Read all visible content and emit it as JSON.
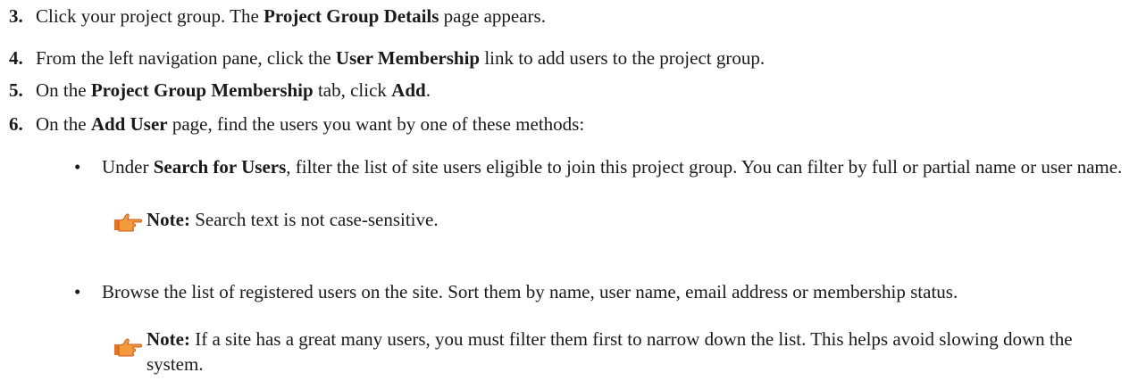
{
  "steps": [
    {
      "num": "3.",
      "pre": "Click your project group. The ",
      "bold1": "Project Group Details",
      "post": " page appears."
    },
    {
      "num": "4.",
      "pre": "From the left navigation pane, click the ",
      "bold1": "User Membership",
      "post": " link to add users to the project group."
    },
    {
      "num": "5.",
      "pre": "On the ",
      "bold1": "Project Group Membership",
      "mid": " tab, click ",
      "bold2": "Add",
      "post": "."
    },
    {
      "num": "6.",
      "pre": "On the ",
      "bold1": "Add User",
      "post": " page, find the users you want by one of these methods:"
    }
  ],
  "bullets": [
    {
      "symbol": "•",
      "pre": "Under ",
      "bold": "Search for Users",
      "post": ", filter the list of site users eligible to join this project group. You can filter by full or partial name or user name.",
      "note": {
        "label": "Note:",
        "text": "Search text is not case-sensitive."
      }
    },
    {
      "symbol": "•",
      "text": "Browse the list of registered users on the site. Sort them by name, user name, email address or membership status.",
      "note": {
        "label": "Note:",
        "text": "If a site has a great many users, you must filter them first to narrow down the list. This helps avoid slowing down the system."
      }
    }
  ],
  "icons": {
    "note": "pointing-hand-icon",
    "note_color": "#e8731c"
  }
}
